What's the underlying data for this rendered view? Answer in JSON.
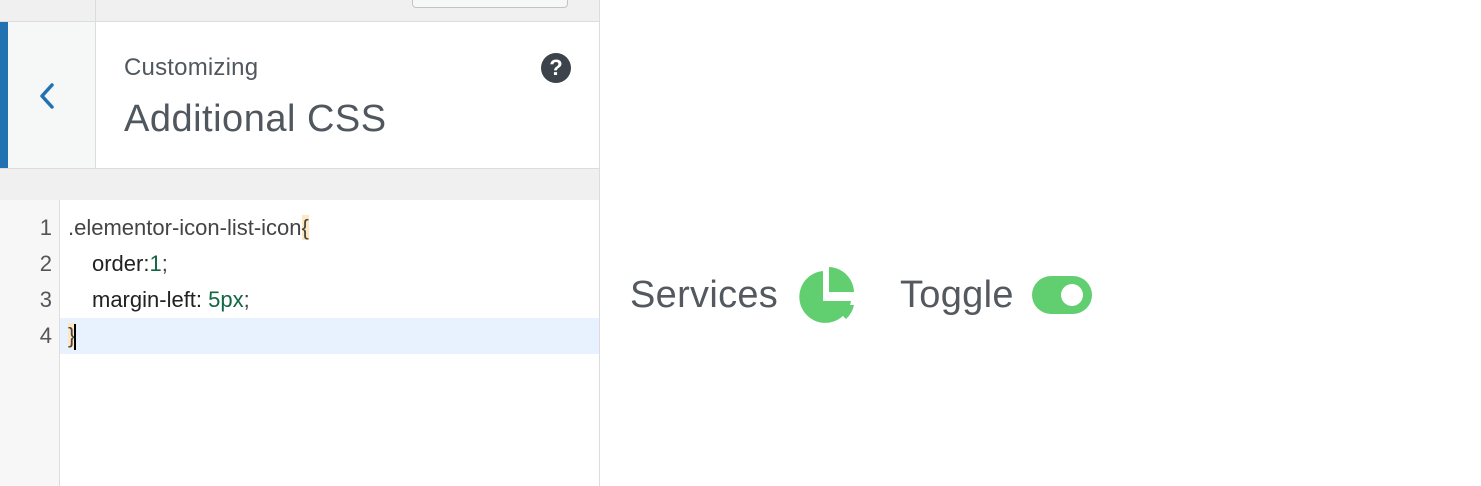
{
  "header": {
    "preamble": "Customizing",
    "title": "Additional CSS",
    "help_glyph": "?"
  },
  "editor": {
    "lines": [
      {
        "number": "1",
        "selector": ".elementor-icon-list-icon",
        "brace": "{"
      },
      {
        "number": "2",
        "property": "order:",
        "value": "1",
        "end": ";"
      },
      {
        "number": "3",
        "property": "margin-left: ",
        "value": "5px",
        "end": ";"
      },
      {
        "number": "4",
        "brace": "}"
      }
    ],
    "active_line": 4
  },
  "preview": {
    "items": [
      {
        "label": "Services",
        "icon": "pie-chart-icon"
      },
      {
        "label": "Toggle",
        "icon": "toggle-on-icon"
      }
    ],
    "icon_color": "#61ce70"
  },
  "colors": {
    "accent": "#2271b1",
    "number": "#116644",
    "active_line": "#e8f2ff"
  }
}
